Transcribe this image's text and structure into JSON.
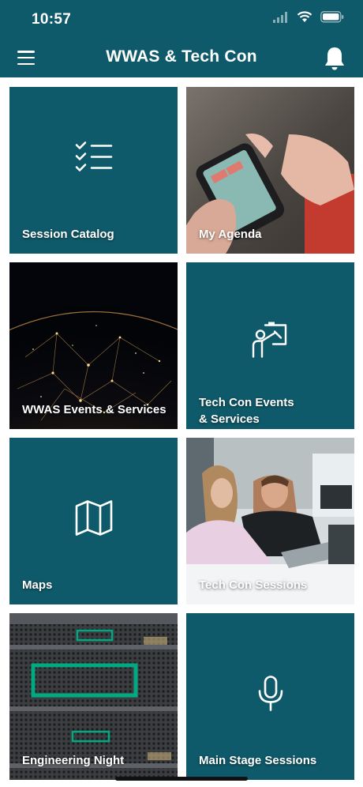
{
  "status_bar": {
    "time": "10:57"
  },
  "header": {
    "title": "WWAS & Tech Con"
  },
  "tiles": [
    {
      "label": "Session Catalog",
      "icon": "checklist-icon"
    },
    {
      "label": "My Agenda",
      "icon": "phone-photo"
    },
    {
      "label": "WWAS Events & Services",
      "icon": "globe-network-photo"
    },
    {
      "label": "Tech Con Events\n& Services",
      "icon": "presenter-board-icon"
    },
    {
      "label": "Maps",
      "icon": "map-icon"
    },
    {
      "label": "Tech Con Sessions",
      "icon": "people-laptop-photo"
    },
    {
      "label": "Engineering Night",
      "icon": "server-rack-photo"
    },
    {
      "label": "Main Stage Sessions",
      "icon": "microphone-icon"
    }
  ],
  "colors": {
    "brand": "#0f5a6a",
    "accent": "#01a982"
  }
}
